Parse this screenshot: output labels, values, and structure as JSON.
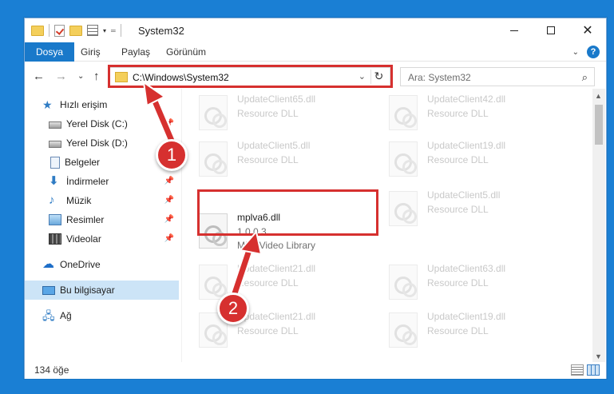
{
  "window": {
    "title": "System32"
  },
  "ribbon": {
    "tabs": [
      "Dosya",
      "Giriş",
      "Paylaş",
      "Görünüm"
    ]
  },
  "address": {
    "path": "C:\\Windows\\System32"
  },
  "search": {
    "placeholder": "Ara: System32"
  },
  "sidebar": {
    "items": [
      {
        "label": "Hızlı erişim",
        "icon": "star-icon"
      },
      {
        "label": "Yerel Disk (C:)",
        "icon": "disk-icon",
        "pinned": true
      },
      {
        "label": "Yerel Disk (D:)",
        "icon": "disk-icon"
      },
      {
        "label": "Belgeler",
        "icon": "document-icon",
        "pinned": true
      },
      {
        "label": "İndirmeler",
        "icon": "download-icon",
        "pinned": true
      },
      {
        "label": "Müzik",
        "icon": "music-icon",
        "pinned": true
      },
      {
        "label": "Resimler",
        "icon": "pictures-icon",
        "pinned": true
      },
      {
        "label": "Videolar",
        "icon": "video-icon",
        "pinned": true
      },
      {
        "label": "OneDrive",
        "icon": "cloud-icon"
      },
      {
        "label": "Bu bilgisayar",
        "icon": "computer-icon",
        "selected": true
      },
      {
        "label": "Ağ",
        "icon": "network-icon"
      }
    ]
  },
  "files": [
    {
      "name": "UpdateClient65.dll",
      "type": "Resource DLL"
    },
    {
      "name": "UpdateClient42.dll",
      "type": "Resource DLL"
    },
    {
      "name": "UpdateClient5.dll",
      "type": "Resource DLL"
    },
    {
      "name": "UpdateClient19.dll",
      "type": "Resource DLL"
    },
    {
      "name": "mplva6.dll",
      "version": "1.0.0.3",
      "type": "MPL Video Library"
    },
    {
      "name": "UpdateClient5.dll",
      "type": "Resource DLL"
    },
    {
      "name": "UpdateClient21.dll",
      "type": "Resource DLL"
    },
    {
      "name": "UpdateClient63.dll",
      "type": "Resource DLL"
    },
    {
      "name": "UpdateClient21.dll",
      "type": "Resource DLL"
    },
    {
      "name": "UpdateClient19.dll",
      "type": "Resource DLL"
    }
  ],
  "status": {
    "count": "134 öğe"
  },
  "annotations": {
    "badge_1": "1",
    "badge_2": "2",
    "color": "#d6302f"
  }
}
